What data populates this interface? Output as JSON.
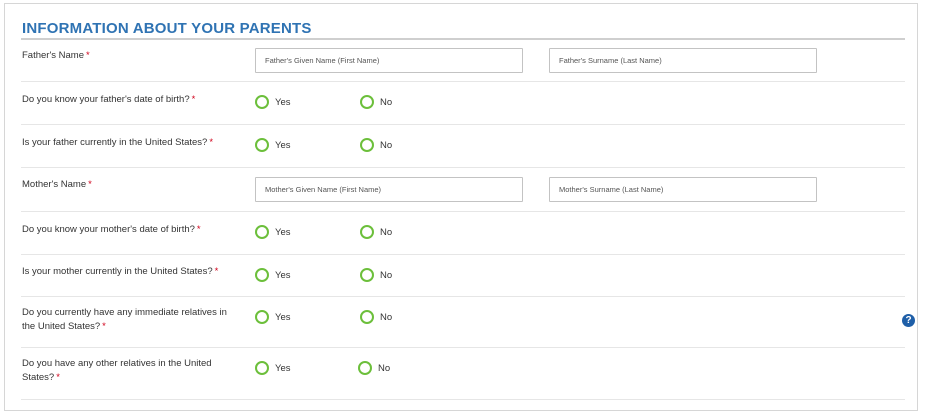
{
  "section": {
    "title": "INFORMATION ABOUT YOUR PARENTS"
  },
  "required_marker": "*",
  "father_name": {
    "label": "Father's Name",
    "given_placeholder": "Father's Given Name (First Name)",
    "surname_placeholder": "Father's Surname (Last Name)"
  },
  "father_dob": {
    "label": "Do you know your father's date of birth?",
    "yes": "Yes",
    "no": "No"
  },
  "father_us": {
    "label": "Is your father currently in the United States?",
    "yes": "Yes",
    "no": "No"
  },
  "mother_name": {
    "label": "Mother's Name",
    "given_placeholder": "Mother's Given Name (First Name)",
    "surname_placeholder": "Mother's Surname (Last Name)"
  },
  "mother_dob": {
    "label": "Do you know your mother's date of birth?",
    "yes": "Yes",
    "no": "No"
  },
  "mother_us": {
    "label": "Is your mother currently in the United States?",
    "yes": "Yes",
    "no": "No"
  },
  "immediate_relatives": {
    "label": "Do you currently have any immediate relatives in the United States?",
    "yes": "Yes",
    "no": "No"
  },
  "other_relatives": {
    "label": "Do you have any other relatives in the United States?",
    "yes": "Yes",
    "no": "No"
  },
  "help": {
    "glyph": "?",
    "icon": "question-circle-icon"
  },
  "colors": {
    "title": "#2f73b3",
    "radio_border": "#6cbf3b",
    "required": "#d0021b",
    "help_bg": "#1f5fa8"
  }
}
